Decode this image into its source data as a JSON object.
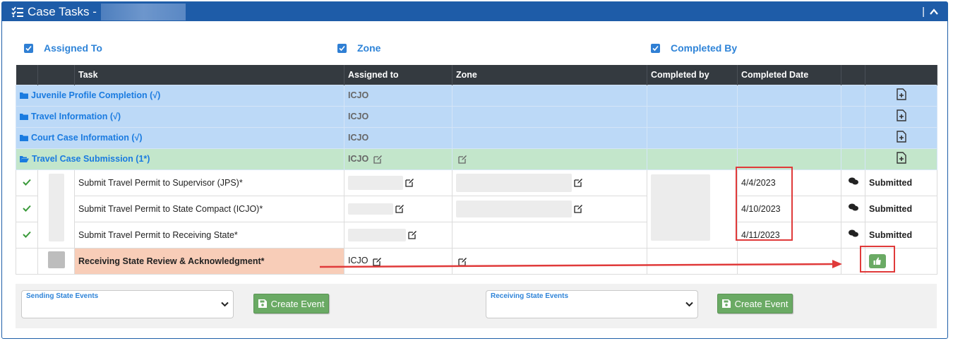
{
  "header": {
    "title": "Case Tasks -",
    "collapse_sep": "|"
  },
  "filters": [
    {
      "label": "Assigned To",
      "checked": true
    },
    {
      "label": "Zone",
      "checked": true
    },
    {
      "label": "Completed By",
      "checked": true
    }
  ],
  "table": {
    "columns": [
      "",
      "",
      "Task",
      "Assigned to",
      "Zone",
      "Completed by",
      "Completed Date",
      "",
      ""
    ],
    "folders": [
      {
        "name": "Juvenile Profile Completion (√)",
        "assigned": "ICJO",
        "state": "collapsed"
      },
      {
        "name": "Travel Information (√)",
        "assigned": "ICJO",
        "state": "collapsed"
      },
      {
        "name": "Court Case Information (√)",
        "assigned": "ICJO",
        "state": "collapsed"
      },
      {
        "name": "Travel Case Submission (1*)",
        "assigned": "ICJO",
        "state": "expanded"
      }
    ],
    "tasks": [
      {
        "task": "Submit Travel Permit to Supervisor (JPS)*",
        "date": "4/4/2023",
        "status": "Submitted"
      },
      {
        "task": "Submit Travel Permit to State Compact (ICJO)*",
        "date": "4/10/2023",
        "status": "Submitted"
      },
      {
        "task": "Submit Travel Permit to Receiving State*",
        "date": "4/11/2023",
        "status": "Submitted"
      }
    ],
    "pending_task": {
      "task": "Receiving State Review & Acknowledgment*",
      "assigned": "ICJO"
    }
  },
  "events": {
    "sending_label": "Sending State Events",
    "receiving_label": "Receiving State Events",
    "create_label": "Create Event"
  },
  "colors": {
    "header": "#1e5ca8",
    "accent": "#2f84d8",
    "folder": "#bcd9f7",
    "folder_open": "#c3e6cb",
    "button": "#6aaa64",
    "highlight": "#e03a3a"
  }
}
